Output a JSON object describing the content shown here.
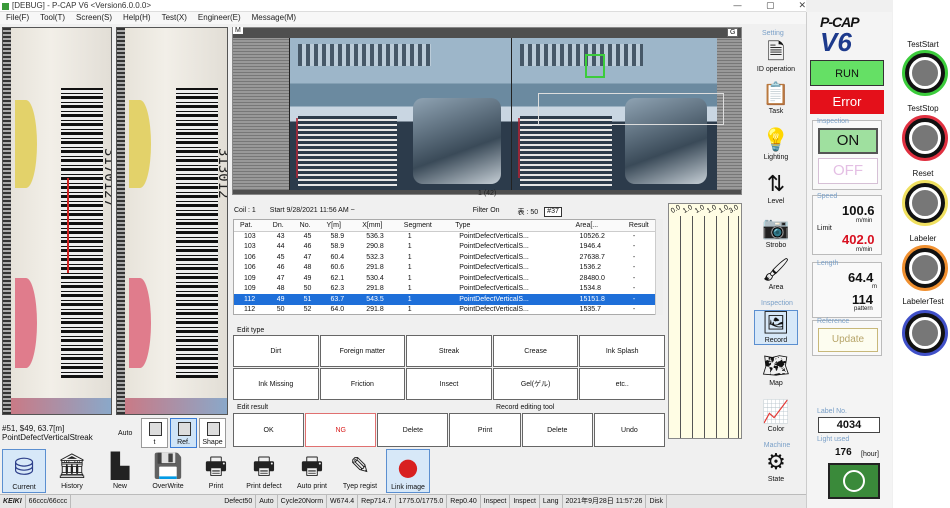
{
  "titlebar": {
    "title": "[DEBUG] - P-CAP V6  <Version6.0.0.0>",
    "min": "—",
    "max": "▢",
    "close": "✕"
  },
  "menu": [
    "File(F)",
    "Tool(T)",
    "Screen(S)",
    "Help(H)",
    "Test(X)",
    "Engineer(E)",
    "Message(M)"
  ],
  "left": {
    "barcode_digits": "3170127",
    "barcode_digits_b": "313012",
    "meas_line1": "#51, $49, 63.7[m]",
    "meas_line2": "PointDefectVerticalStreak",
    "auto": "Auto",
    "buttons": [
      {
        "label": "t",
        "sel": false
      },
      {
        "label": "Ref.",
        "sel": true
      },
      {
        "label": "Shape",
        "sel": false
      }
    ]
  },
  "toolbar": [
    {
      "label": "Current",
      "icon": "database-icon"
    },
    {
      "label": "History",
      "icon": "history-icon"
    },
    {
      "label": "New",
      "icon": "new-icon"
    },
    {
      "label": "OverWrite",
      "icon": "save-icon"
    },
    {
      "label": "Print",
      "icon": "printer-icon"
    },
    {
      "label": "Print defect",
      "icon": "print-defect-icon"
    },
    {
      "label": "Auto print",
      "icon": "auto-print-icon"
    },
    {
      "label": "Tyep regist",
      "icon": "type-regist-icon"
    },
    {
      "label": "Link image",
      "icon": "apple-icon"
    }
  ],
  "statusbar": [
    "KEIKI",
    "66ccc/66ccc",
    "Defect50",
    "Auto",
    "Cycle20Norm",
    "W674.4",
    "Rep714.7",
    "1775.0/1775.0",
    "Rep0.40",
    "Inspect",
    "Inspect",
    "Lang",
    "2021年9月28日 11:57:26",
    "Disk"
  ],
  "map": {
    "label": "M",
    "badge": "G",
    "count": "1 (42)"
  },
  "info": {
    "coil": "Coil : 1",
    "start": "Start 9/28/2021 11:56 AM ~",
    "filter": "Filter On",
    "table_label": "表 : 50",
    "badge": "#37"
  },
  "table": {
    "headers": [
      "Pat.",
      "Dn.",
      "No.",
      "Y[m]",
      "X[mm]",
      "Segment",
      "Type",
      "Area[...",
      "Result"
    ],
    "rows": [
      [
        "103",
        "43",
        "45",
        "58.9",
        "536.3",
        "1",
        "PointDefectVerticalS...",
        "10526.2",
        "-"
      ],
      [
        "103",
        "44",
        "46",
        "58.9",
        "290.8",
        "1",
        "PointDefectVerticalS...",
        "1946.4",
        "-"
      ],
      [
        "106",
        "45",
        "47",
        "60.4",
        "532.3",
        "1",
        "PointDefectVerticalS...",
        "27638.7",
        "-"
      ],
      [
        "106",
        "46",
        "48",
        "60.6",
        "291.8",
        "1",
        "PointDefectVerticalS...",
        "1536.2",
        "-"
      ],
      [
        "109",
        "47",
        "49",
        "62.1",
        "530.4",
        "1",
        "PointDefectVerticalS...",
        "28480.0",
        "-"
      ],
      [
        "109",
        "48",
        "50",
        "62.3",
        "291.8",
        "1",
        "PointDefectVerticalS...",
        "1534.8",
        "-"
      ],
      [
        "112",
        "49",
        "51",
        "63.7",
        "543.5",
        "1",
        "PointDefectVerticalS...",
        "15151.8",
        "-"
      ],
      [
        "112",
        "50",
        "52",
        "64.0",
        "291.8",
        "1",
        "PointDefectVerticalS...",
        "1535.7",
        "-"
      ]
    ]
  },
  "edit_type": {
    "label": "Edit type",
    "buttons": [
      "Dirt",
      "Foreign matter",
      "Streak",
      "Crease",
      "Ink Splash",
      "Ink Missing",
      "Friction",
      "Insect",
      "Gel(ゲル)",
      "etc.."
    ]
  },
  "edit_result": {
    "label": "Edit result",
    "buttons": [
      "OK",
      "NG",
      "Delete",
      "Print"
    ]
  },
  "record_edit": {
    "label": "Record editing tool",
    "buttons": [
      "Delete",
      "Undo"
    ]
  },
  "strips": {
    "headers": [
      "0.0",
      "1.0",
      "1.0",
      "1.0",
      "1.0",
      "3.0"
    ]
  },
  "side": {
    "setting": "Setting",
    "inspection": "Inspection",
    "machine": "Machine",
    "items": [
      {
        "label": "ID operation",
        "glyph": "🗎"
      },
      {
        "label": "Task",
        "glyph": "📋"
      },
      {
        "label": "Lighting",
        "glyph": "💡"
      },
      {
        "label": "Level",
        "glyph": "⇅"
      },
      {
        "label": "Strobo",
        "glyph": "📷"
      },
      {
        "label": "Area",
        "glyph": "🖌"
      },
      {
        "label": "Record",
        "glyph": "🖼"
      },
      {
        "label": "Map",
        "glyph": "🗺"
      },
      {
        "label": "Color",
        "glyph": "📈"
      },
      {
        "label": "State",
        "glyph": "⚙"
      }
    ]
  },
  "panel": {
    "brand1": "P-CAP",
    "brand2": "V6",
    "run": "RUN",
    "error": "Error",
    "inspection_title": "Inspection",
    "on": "ON",
    "off": "OFF",
    "speed_title": "Speed",
    "speed": "100.6",
    "speed_unit": "m/min",
    "limit_label": "Limit",
    "limit": "402.0",
    "limit_unit": "m/min",
    "length_title": "Length",
    "length": "64.4",
    "length_unit": "m",
    "pattern": "114",
    "pattern_unit": "pattern",
    "reference_title": "Reference",
    "update": "Update",
    "label_no_title": "Label No.",
    "label_no": "4034",
    "light_title": "Light used",
    "light_hours": "176",
    "light_unit": "[hour]"
  },
  "rightbuttons": [
    {
      "label": "TestStart",
      "color": "#3ccc3c"
    },
    {
      "label": "TestStop",
      "color": "#e03040"
    },
    {
      "label": "Reset",
      "color": "#f0e060"
    },
    {
      "label": "Labeler",
      "color": "#f09030"
    },
    {
      "label": "LabelerTest",
      "color": "#4050c8"
    }
  ]
}
